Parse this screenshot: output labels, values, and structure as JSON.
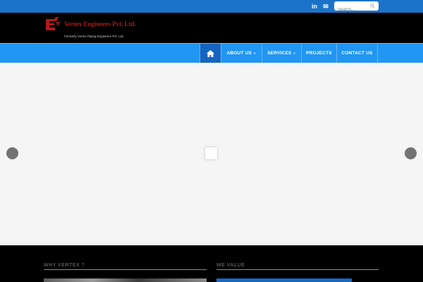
{
  "topbar": {
    "linkedin_label": "in",
    "email_label": "✉",
    "search_placeholder": "Search..."
  },
  "header": {
    "company_name": "Vertex Engineers Pvt. Ltd.",
    "company_sub": "Formerly Vertex Piping Engineers Pvt. Ltd."
  },
  "nav": {
    "home_icon": "home-icon",
    "items": [
      {
        "label": "ABOUT US",
        "has_dropdown": true
      },
      {
        "label": "SERVICES",
        "has_dropdown": true
      },
      {
        "label": "PROJECTS",
        "has_dropdown": false
      },
      {
        "label": "CONTACT US",
        "has_dropdown": false
      }
    ],
    "dropdown_glyph": "▼"
  },
  "footer": {
    "col1_title": "WHY VERTEX ?",
    "col2_title": "WE VALUE"
  },
  "colors": {
    "topbar": "#1a73c9",
    "nav": "#2196f3",
    "nav_active": "#1565c0",
    "logo_red": "#b3191c",
    "slider_bg": "#f5f5f5"
  }
}
